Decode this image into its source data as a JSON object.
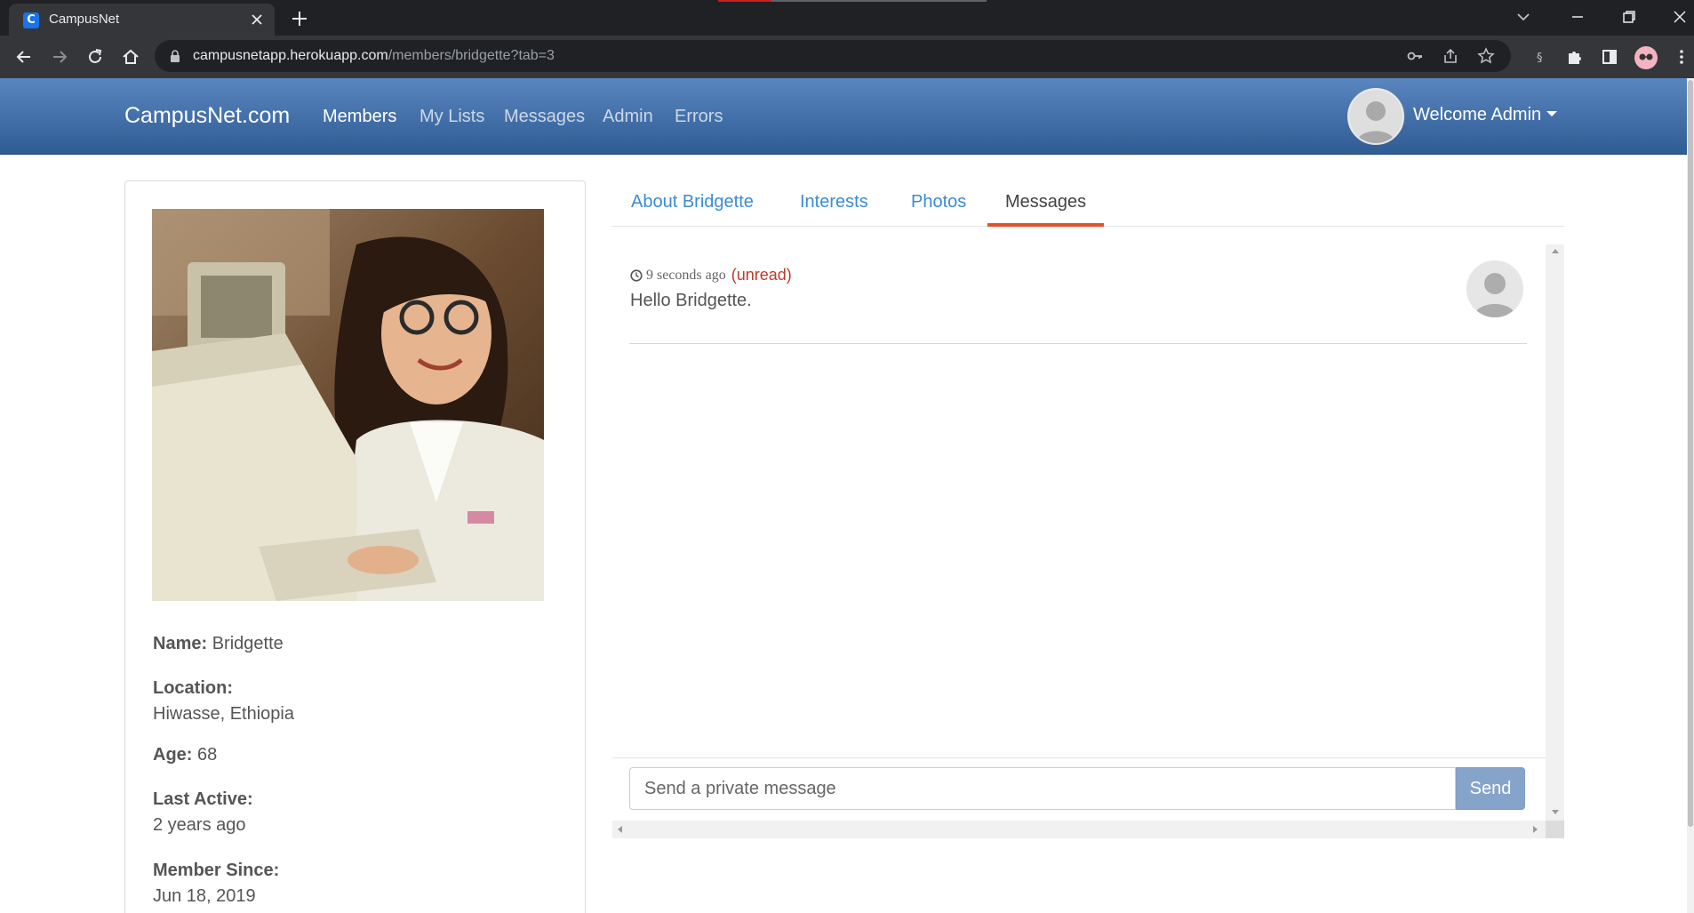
{
  "browser": {
    "tab_title": "CampusNet",
    "tab_favicon_letter": "C",
    "url_host": "campusnetapp.herokuapp.com",
    "url_path": "/members/bridgette?tab=3"
  },
  "navbar": {
    "brand": "CampusNet.com",
    "links": [
      "Members",
      "My Lists",
      "Messages",
      "Admin",
      "Errors"
    ],
    "active_link": "Members",
    "welcome": "Welcome Admin"
  },
  "profile": {
    "name_label": "Name:",
    "name": "Bridgette",
    "location_label": "Location:",
    "location": "Hiwasse, Ethiopia",
    "age_label": "Age:",
    "age": "68",
    "last_active_label": "Last Active:",
    "last_active": "2 years ago",
    "member_since_label": "Member Since:",
    "member_since": "Jun 18, 2019"
  },
  "tabs": {
    "items": [
      "About Bridgette",
      "Interests",
      "Photos",
      "Messages"
    ],
    "active": "Messages"
  },
  "messages": [
    {
      "time": "9 seconds ago",
      "status": "(unread)",
      "text": "Hello Bridgette."
    }
  ],
  "compose": {
    "placeholder": "Send a private message",
    "send_label": "Send"
  },
  "colors": {
    "navbar_top": "#5a86c0",
    "navbar_bottom": "#2f5c93",
    "tab_link": "#3a8bd6",
    "tab_active_underline": "#e1522b",
    "unread": "#c0392b",
    "send_button": "#86a4ca"
  }
}
